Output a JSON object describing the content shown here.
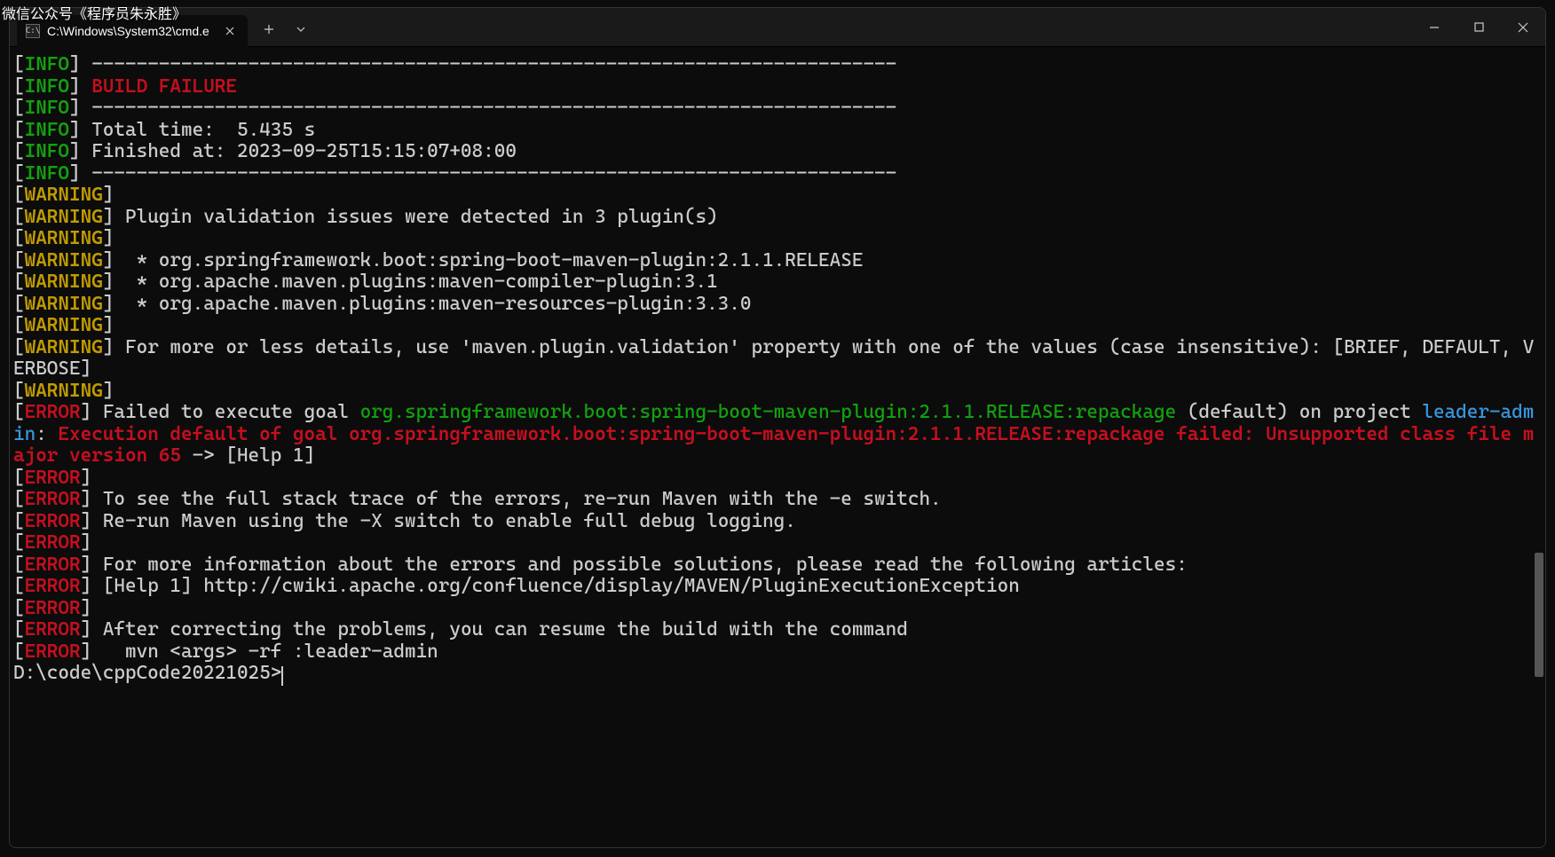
{
  "watermark": "微信公众号《程序员朱永胜》",
  "tab": {
    "title": "C:\\Windows\\System32\\cmd.e",
    "icon_glyph": "C:\\"
  },
  "lines": [
    {
      "segments": [
        {
          "type": "tag",
          "level": "INFO"
        },
        {
          "type": "text",
          "cls": "white-text",
          "text": " ------------------------------------------------------------------------"
        }
      ]
    },
    {
      "segments": [
        {
          "type": "tag",
          "level": "INFO"
        },
        {
          "type": "text",
          "cls": "white-text",
          "text": " "
        },
        {
          "type": "text",
          "cls": "red-bold",
          "text": "BUILD FAILURE"
        }
      ]
    },
    {
      "segments": [
        {
          "type": "tag",
          "level": "INFO"
        },
        {
          "type": "text",
          "cls": "white-text",
          "text": " ------------------------------------------------------------------------"
        }
      ]
    },
    {
      "segments": [
        {
          "type": "tag",
          "level": "INFO"
        },
        {
          "type": "text",
          "cls": "white-text",
          "text": " Total time:  5.435 s"
        }
      ]
    },
    {
      "segments": [
        {
          "type": "tag",
          "level": "INFO"
        },
        {
          "type": "text",
          "cls": "white-text",
          "text": " Finished at: 2023-09-25T15:15:07+08:00"
        }
      ]
    },
    {
      "segments": [
        {
          "type": "tag",
          "level": "INFO"
        },
        {
          "type": "text",
          "cls": "white-text",
          "text": " ------------------------------------------------------------------------"
        }
      ]
    },
    {
      "segments": [
        {
          "type": "tag",
          "level": "WARNING"
        },
        {
          "type": "text",
          "cls": "white-text",
          "text": " "
        }
      ]
    },
    {
      "segments": [
        {
          "type": "tag",
          "level": "WARNING"
        },
        {
          "type": "text",
          "cls": "white-text",
          "text": " Plugin validation issues were detected in 3 plugin(s)"
        }
      ]
    },
    {
      "segments": [
        {
          "type": "tag",
          "level": "WARNING"
        },
        {
          "type": "text",
          "cls": "white-text",
          "text": " "
        }
      ]
    },
    {
      "segments": [
        {
          "type": "tag",
          "level": "WARNING"
        },
        {
          "type": "text",
          "cls": "white-text",
          "text": "  * org.springframework.boot:spring-boot-maven-plugin:2.1.1.RELEASE"
        }
      ]
    },
    {
      "segments": [
        {
          "type": "tag",
          "level": "WARNING"
        },
        {
          "type": "text",
          "cls": "white-text",
          "text": "  * org.apache.maven.plugins:maven-compiler-plugin:3.1"
        }
      ]
    },
    {
      "segments": [
        {
          "type": "tag",
          "level": "WARNING"
        },
        {
          "type": "text",
          "cls": "white-text",
          "text": "  * org.apache.maven.plugins:maven-resources-plugin:3.3.0"
        }
      ]
    },
    {
      "segments": [
        {
          "type": "tag",
          "level": "WARNING"
        },
        {
          "type": "text",
          "cls": "white-text",
          "text": " "
        }
      ]
    },
    {
      "segments": [
        {
          "type": "tag",
          "level": "WARNING"
        },
        {
          "type": "text",
          "cls": "white-text",
          "text": " For more or less details, use 'maven.plugin.validation' property with one of the values (case insensitive): [BRIEF, DEFAULT, VERBOSE]"
        }
      ]
    },
    {
      "segments": [
        {
          "type": "tag",
          "level": "WARNING"
        },
        {
          "type": "text",
          "cls": "white-text",
          "text": " "
        }
      ]
    },
    {
      "segments": [
        {
          "type": "tag",
          "level": "ERROR"
        },
        {
          "type": "text",
          "cls": "white-text",
          "text": " Failed to execute goal "
        },
        {
          "type": "text",
          "cls": "green-text",
          "text": "org.springframework.boot:spring-boot-maven-plugin:2.1.1.RELEASE:repackage"
        },
        {
          "type": "text",
          "cls": "white-text",
          "text": " (default) on project "
        },
        {
          "type": "text",
          "cls": "cyan-text",
          "text": "leader-admin"
        },
        {
          "type": "text",
          "cls": "white-text",
          "text": ": "
        },
        {
          "type": "text",
          "cls": "red-bold",
          "text": "Execution default of goal org.springframework.boot:spring-boot-maven-plugin:2.1.1.RELEASE:repackage failed: Unsupported class file major version 65"
        },
        {
          "type": "text",
          "cls": "white-text",
          "text": " -> [Help 1]"
        }
      ]
    },
    {
      "segments": [
        {
          "type": "tag",
          "level": "ERROR"
        },
        {
          "type": "text",
          "cls": "white-text",
          "text": " "
        }
      ]
    },
    {
      "segments": [
        {
          "type": "tag",
          "level": "ERROR"
        },
        {
          "type": "text",
          "cls": "white-text",
          "text": " To see the full stack trace of the errors, re-run Maven with the -e switch."
        }
      ]
    },
    {
      "segments": [
        {
          "type": "tag",
          "level": "ERROR"
        },
        {
          "type": "text",
          "cls": "white-text",
          "text": " Re-run Maven using the -X switch to enable full debug logging."
        }
      ]
    },
    {
      "segments": [
        {
          "type": "tag",
          "level": "ERROR"
        },
        {
          "type": "text",
          "cls": "white-text",
          "text": " "
        }
      ]
    },
    {
      "segments": [
        {
          "type": "tag",
          "level": "ERROR"
        },
        {
          "type": "text",
          "cls": "white-text",
          "text": " For more information about the errors and possible solutions, please read the following articles:"
        }
      ]
    },
    {
      "segments": [
        {
          "type": "tag",
          "level": "ERROR"
        },
        {
          "type": "text",
          "cls": "white-text",
          "text": " [Help 1] http://cwiki.apache.org/confluence/display/MAVEN/PluginExecutionException"
        }
      ]
    },
    {
      "segments": [
        {
          "type": "tag",
          "level": "ERROR"
        },
        {
          "type": "text",
          "cls": "white-text",
          "text": " "
        }
      ]
    },
    {
      "segments": [
        {
          "type": "tag",
          "level": "ERROR"
        },
        {
          "type": "text",
          "cls": "white-text",
          "text": " After correcting the problems, you can resume the build with the command"
        }
      ]
    },
    {
      "segments": [
        {
          "type": "tag",
          "level": "ERROR"
        },
        {
          "type": "text",
          "cls": "white-text",
          "text": "   mvn <args> -rf :leader-admin"
        }
      ]
    },
    {
      "segments": [
        {
          "type": "text",
          "cls": "white-text",
          "text": ""
        }
      ]
    }
  ],
  "prompt": "D:\\code\\cppCode20221025>"
}
